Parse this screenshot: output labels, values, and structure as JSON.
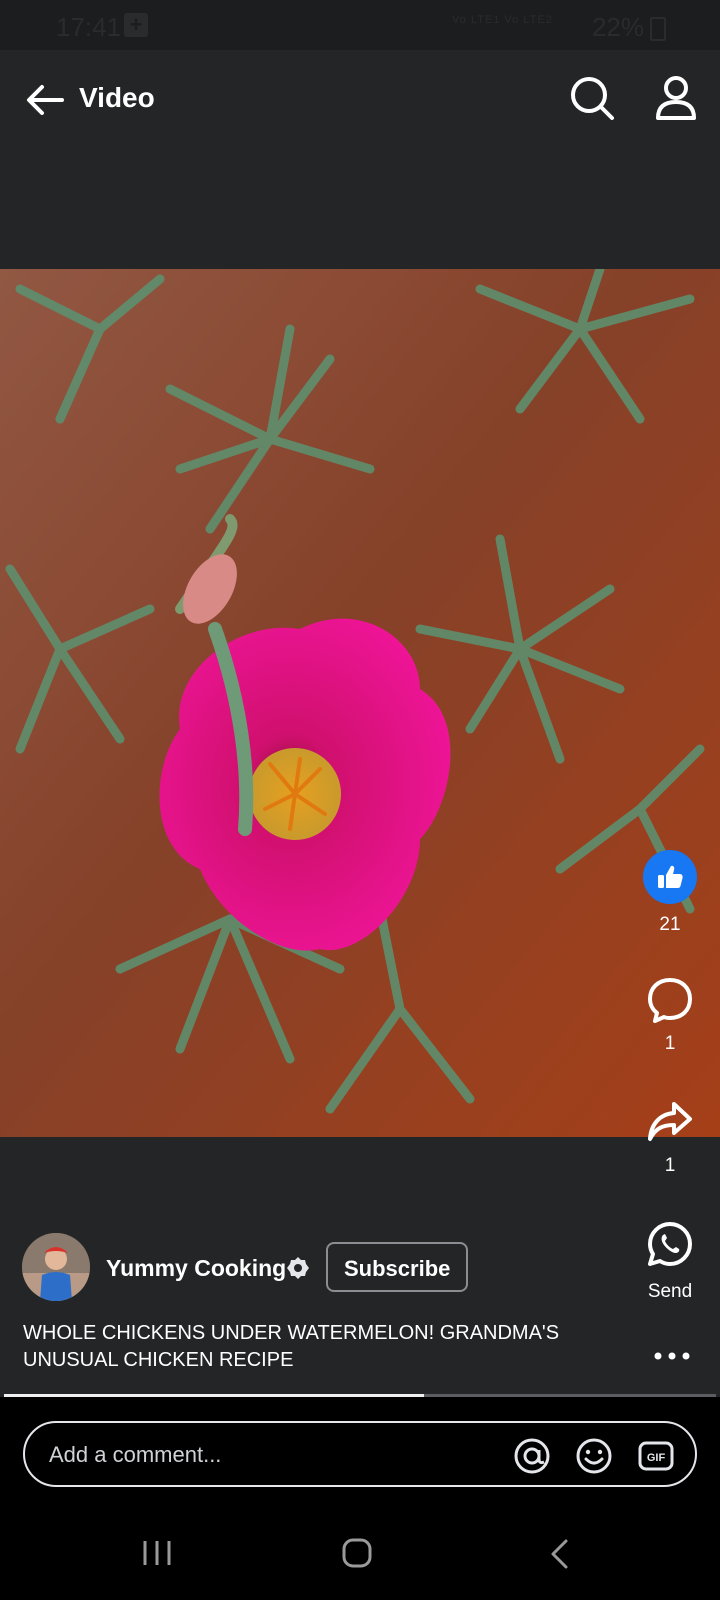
{
  "status_bar": {
    "time": "17:41",
    "network": "Vo LTE1 Vo LTE2",
    "battery": "22%"
  },
  "header": {
    "title": "Video",
    "back_icon": "arrow-left-icon",
    "search_icon": "search-icon",
    "profile_icon": "profile-icon"
  },
  "actions": {
    "like_count": "21",
    "comment_count": "1",
    "share_count": "1",
    "send_label": "Send"
  },
  "channel": {
    "name": "Yummy Cooking",
    "subscribe_label": "Subscribe"
  },
  "video": {
    "title": "WHOLE CHICKENS UNDER WATERMELON! GRANDMA'S UNUSUAL CHICKEN RECIPE",
    "progress": 0.59
  },
  "comment": {
    "placeholder": "Add a comment..."
  },
  "colors": {
    "accent": "#1877f2",
    "background": "#242526",
    "flower": "#e0128a"
  }
}
